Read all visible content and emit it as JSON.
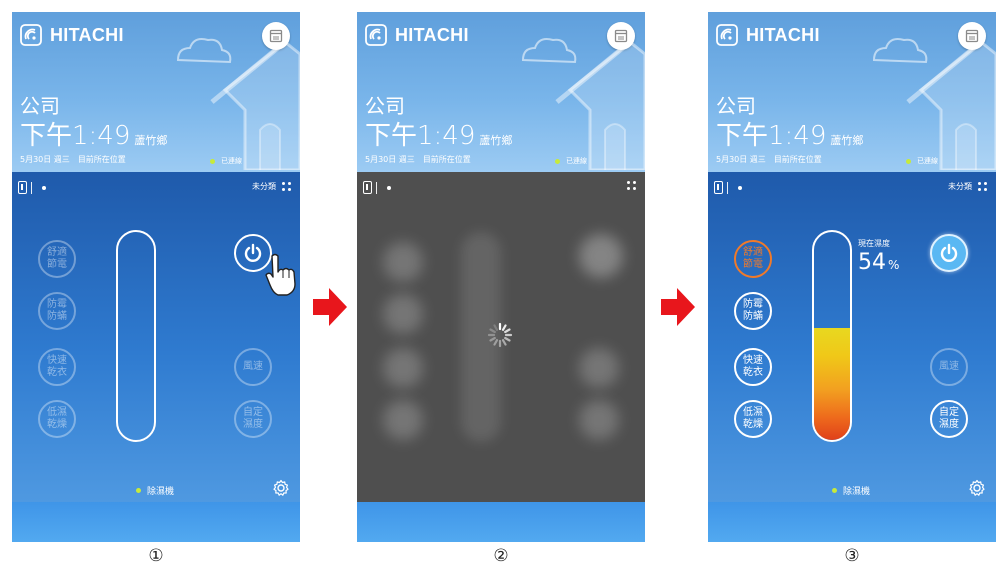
{
  "brand": "HITACHI",
  "header": {
    "place": "公司",
    "time": "下午1:49",
    "location": "蘆竹鄉",
    "date": "5月30日 週三",
    "position_note": "目前所在位置",
    "connection": "已連線"
  },
  "toolbar": {
    "category": "未分類"
  },
  "modes": {
    "comfort": "舒適\n節電",
    "mildew": "防霉\n防蟎",
    "fast_dry": "快速\n乾衣",
    "low_dry": "低濕\n乾燥",
    "wind": "風速",
    "custom": "自定\n濕度"
  },
  "humidity": {
    "label": "現在濕度",
    "value": "54",
    "unit": "%",
    "level": 0.54
  },
  "device": {
    "name": "除濕機"
  },
  "captions": [
    "①",
    "②",
    "③"
  ],
  "colors": {
    "header": "#6aaae2",
    "panel": "#2a6fc4",
    "loading_overlay": "#4f4f4f",
    "active_mode": "#f07a2a",
    "connected_dot": "#c7ea3c",
    "arrow": "#e8161c"
  },
  "icons": [
    "wifi-logo-icon",
    "calendar-icon",
    "house-icon",
    "cloud-icon",
    "power-icon",
    "hand-pointer-icon",
    "gear-icon",
    "loading-spinner-icon",
    "arrow-right-icon"
  ]
}
